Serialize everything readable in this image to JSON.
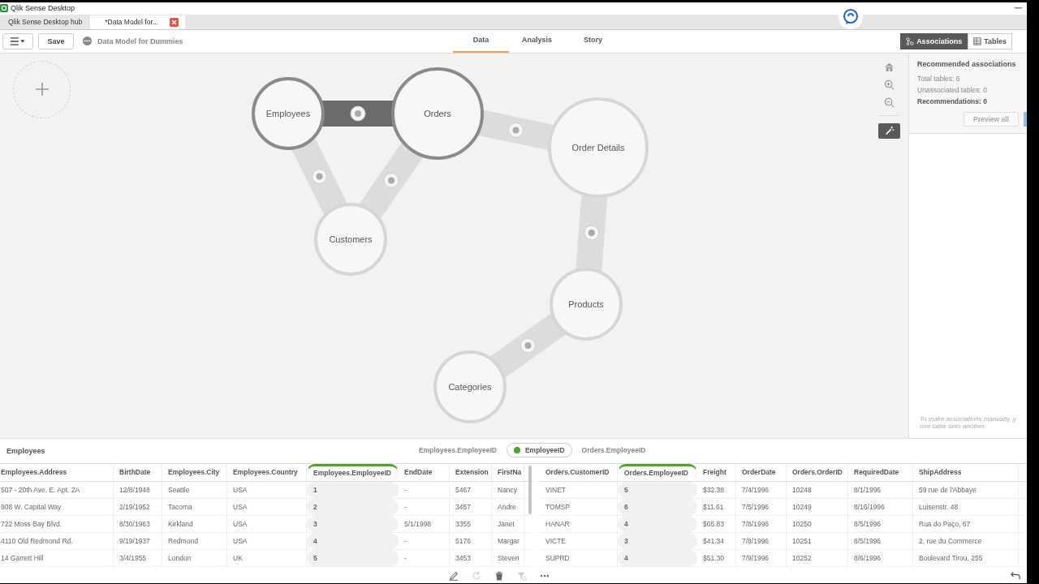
{
  "window": {
    "title": "Qlik Sense Desktop"
  },
  "browser_tabs": [
    {
      "label": "Qlik Sense Desktop hub",
      "selected": false,
      "closable": false
    },
    {
      "label": "*Data Model for...",
      "selected": true,
      "closable": true
    }
  ],
  "toolbar": {
    "save": "Save",
    "app_name": "Data Model for Dummies",
    "nav": [
      {
        "label": "Data",
        "selected": true
      },
      {
        "label": "Analysis",
        "selected": false
      },
      {
        "label": "Story",
        "selected": false
      }
    ],
    "views": [
      {
        "label": "Associations",
        "kind": "associations",
        "selected": true
      },
      {
        "label": "Tables",
        "kind": "tables",
        "selected": false
      }
    ]
  },
  "model": {
    "nodes": [
      {
        "name": "Employees",
        "selected": true
      },
      {
        "name": "Orders",
        "selected": true
      },
      {
        "name": "Order Details",
        "selected": false
      },
      {
        "name": "Customers",
        "selected": false
      },
      {
        "name": "Products",
        "selected": false
      },
      {
        "name": "Categories",
        "selected": false
      }
    ],
    "links": [
      {
        "selected": true
      },
      {
        "selected": false
      },
      {
        "selected": false
      },
      {
        "selected": false
      },
      {
        "selected": false
      },
      {
        "selected": false
      }
    ]
  },
  "recommendations": {
    "title": "Recommended associations",
    "lines": [
      "Total tables: 6",
      "Unassociated tables: 0"
    ],
    "summary": "Recommendations: 0",
    "button": "Preview all",
    "hint_lines": [
      "To make associations manually, y",
      "one table onto another."
    ]
  },
  "preview": {
    "title": "Employees",
    "keys": [
      {
        "label": "Employees.EmployeeID",
        "selected": false
      },
      {
        "label": "EmployeeID",
        "selected": true,
        "color": "#52a02d"
      },
      {
        "label": "Orders.EmployeeID",
        "selected": false
      }
    ],
    "tables": [
      {
        "columns": [
          {
            "label": "Employees.Address",
            "key": false
          },
          {
            "label": "BirthDate",
            "key": false
          },
          {
            "label": "Employees.City",
            "key": false
          },
          {
            "label": "Employees.Country",
            "key": false
          },
          {
            "label": "Employees.EmployeeID",
            "key": true
          },
          {
            "label": "EndDate",
            "key": false
          },
          {
            "label": "Extension",
            "key": false
          },
          {
            "label": "FirstNa",
            "key": false
          }
        ],
        "rows": [
          [
            "507 - 20th Ave. E. Apt. 2A",
            "12/8/1948",
            "Seattle",
            "USA",
            "1",
            "-",
            "5467",
            "Nancy"
          ],
          [
            "908 W. Capital Way",
            "2/19/1952",
            "Tacoma",
            "USA",
            "2",
            "-",
            "3457",
            "Andre"
          ],
          [
            "722 Moss Bay Blvd.",
            "8/30/1963",
            "Kirkland",
            "USA",
            "3",
            "5/1/1998",
            "3355",
            "Janet"
          ],
          [
            "4110 Old Redmond Rd.",
            "9/19/1937",
            "Redmond",
            "USA",
            "4",
            "-",
            "5176",
            "Margar"
          ],
          [
            "14 Garrett Hill",
            "3/4/1955",
            "London",
            "UK",
            "5",
            "-",
            "3453",
            "Steven"
          ]
        ]
      },
      {
        "columns": [
          {
            "label": "Orders.CustomerID",
            "key": false
          },
          {
            "label": "Orders.EmployeeID",
            "key": true
          },
          {
            "label": "Freight",
            "key": false
          },
          {
            "label": "OrderDate",
            "key": false
          },
          {
            "label": "Orders.OrderID",
            "key": false
          },
          {
            "label": "RequiredDate",
            "key": false
          },
          {
            "label": "ShipAddress",
            "key": false
          }
        ],
        "rows": [
          [
            "VINET",
            "5",
            "$32.38",
            "7/4/1996",
            "10248",
            "8/1/1996",
            "59 rue de l'Abbaye"
          ],
          [
            "TOMSP",
            "6",
            "$11.61",
            "7/5/1996",
            "10249",
            "8/16/1996",
            "Luisenstr. 48"
          ],
          [
            "HANAR",
            "4",
            "$65.83",
            "7/8/1996",
            "10250",
            "8/5/1996",
            "Rua do Paço, 67"
          ],
          [
            "VICTE",
            "3",
            "$41.34",
            "7/8/1996",
            "10251",
            "8/5/1996",
            "2, rue du Commerce"
          ],
          [
            "SUPRD",
            "4",
            "$51.30",
            "7/9/1996",
            "10252",
            "8/6/1996",
            "Boulevard Tirou, 255"
          ]
        ]
      }
    ]
  },
  "footer_tools": [
    {
      "kind": "edit",
      "disabled": false
    },
    {
      "kind": "refresh",
      "disabled": true
    },
    {
      "kind": "delete",
      "disabled": false
    },
    {
      "kind": "filter",
      "disabled": true
    },
    {
      "kind": "more",
      "disabled": false
    }
  ]
}
